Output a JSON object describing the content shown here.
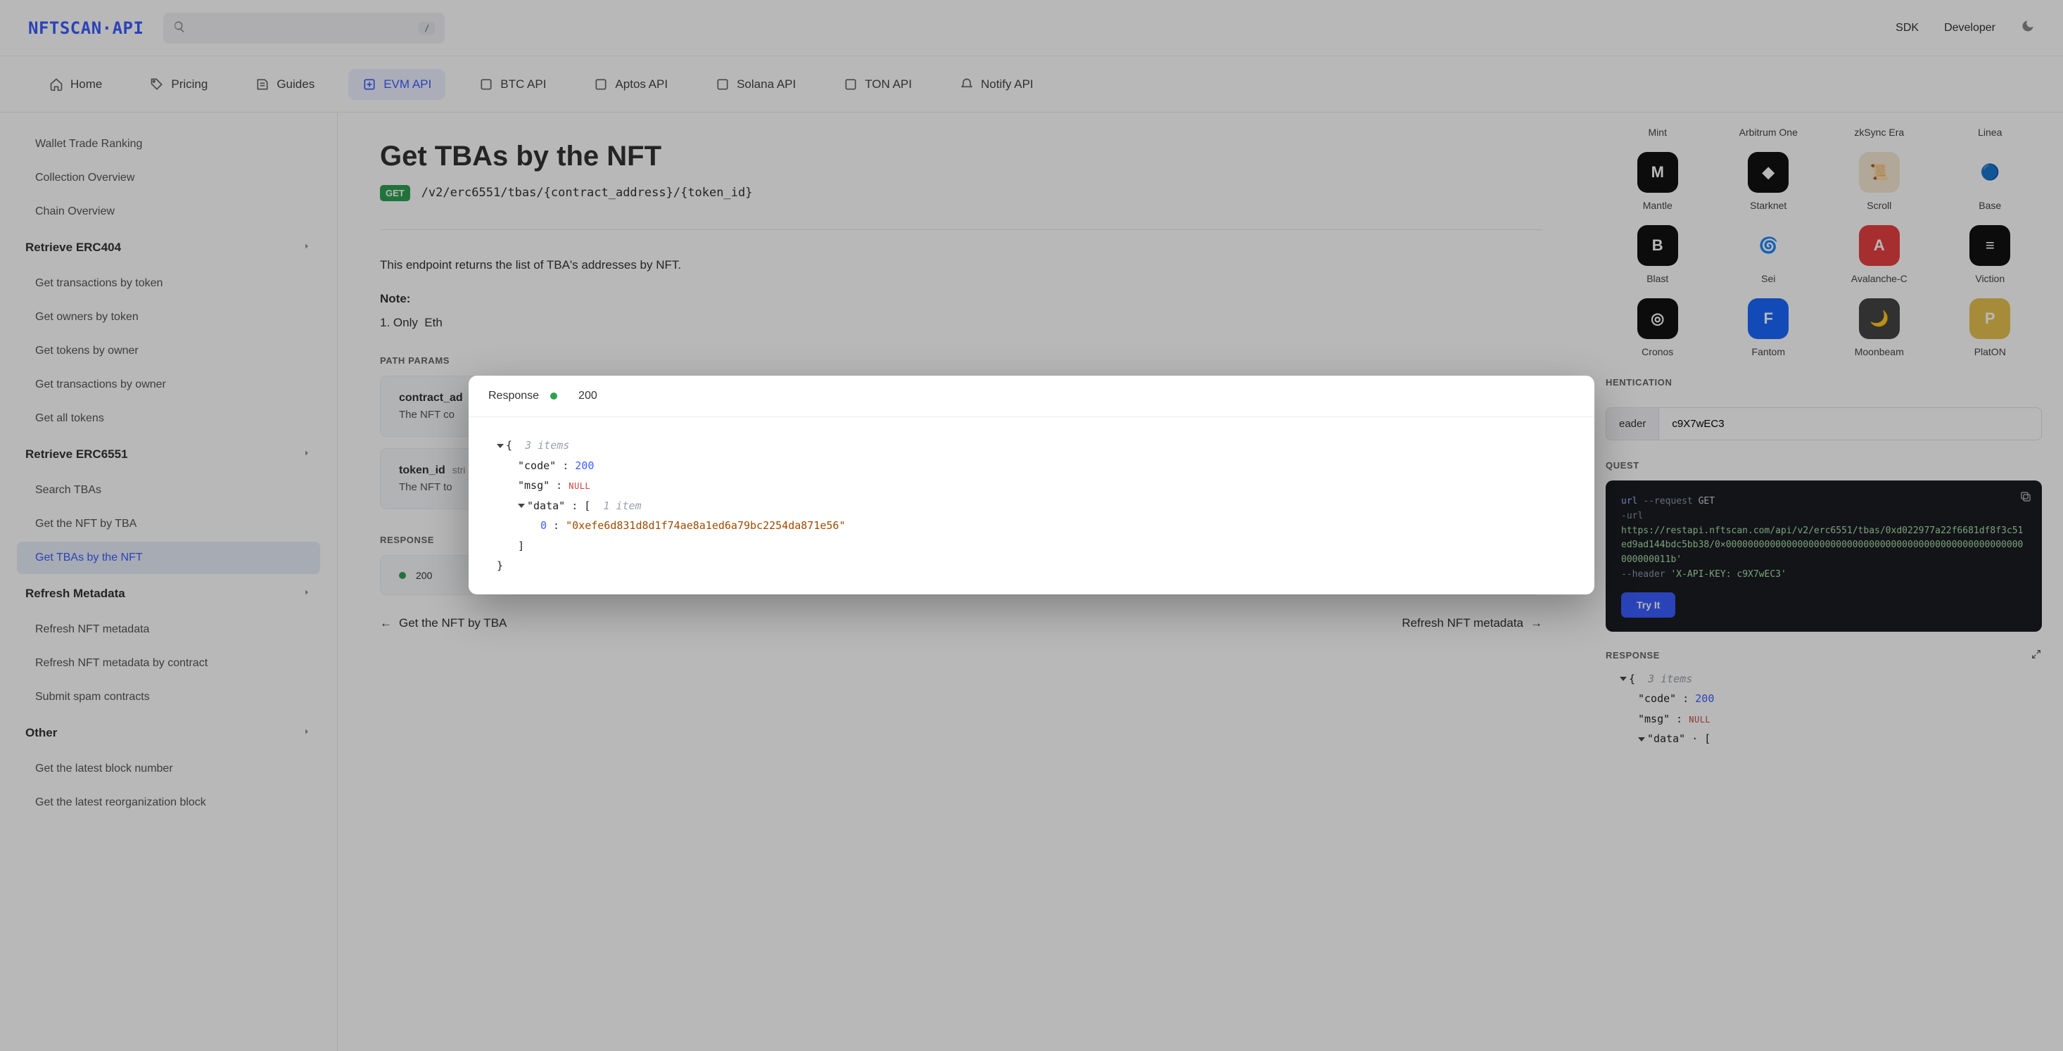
{
  "header": {
    "logo": "NFTSCAN·API",
    "search_placeholder": "",
    "search_shortcut": "/",
    "links": {
      "sdk": "SDK",
      "developer": "Developer"
    }
  },
  "tabs": [
    {
      "label": "Home"
    },
    {
      "label": "Pricing"
    },
    {
      "label": "Guides"
    },
    {
      "label": "EVM API",
      "active": true
    },
    {
      "label": "BTC API"
    },
    {
      "label": "Aptos API"
    },
    {
      "label": "Solana API"
    },
    {
      "label": "TON API"
    },
    {
      "label": "Notify API"
    }
  ],
  "sidebar": {
    "initial_items": [
      "Wallet Trade Ranking",
      "Collection Overview",
      "Chain Overview"
    ],
    "groups": [
      {
        "title": "Retrieve ERC404",
        "items": [
          "Get transactions by token",
          "Get owners by token",
          "Get tokens by owner",
          "Get transactions by owner",
          "Get all tokens"
        ]
      },
      {
        "title": "Retrieve ERC6551",
        "items": [
          "Search TBAs",
          "Get the NFT by TBA",
          "Get TBAs by the NFT"
        ],
        "active_index": 2
      },
      {
        "title": "Refresh Metadata",
        "items": [
          "Refresh NFT metadata",
          "Refresh NFT metadata by contract",
          "Submit spam contracts"
        ]
      },
      {
        "title": "Other",
        "items": [
          "Get the latest block number",
          "Get the latest reorganization block"
        ]
      }
    ]
  },
  "main": {
    "title": "Get TBAs by the NFT",
    "method": "GET",
    "endpoint": "/v2/erc6551/tbas/{contract_address}/{token_id}",
    "description": "This endpoint returns the list of TBA's addresses by NFT.",
    "note_label": "Note:",
    "note_item": "1. Only  Eth",
    "path_params_label": "PATH PARAMS",
    "params": [
      {
        "name": "contract_ad",
        "type": "",
        "desc": "The NFT co"
      },
      {
        "name": "token_id",
        "type": "stri",
        "desc": "The NFT to"
      }
    ],
    "response_label": "RESPONSE",
    "response_status": "200",
    "prev": "Get the NFT by TBA",
    "next": "Refresh NFT metadata"
  },
  "right": {
    "chains_top": [
      "Mint",
      "Arbitrum One",
      "zkSync Era",
      "Linea"
    ],
    "chains": [
      {
        "name": "Mantle",
        "bg": "#111",
        "glyph": "M"
      },
      {
        "name": "Starknet",
        "bg": "#111",
        "glyph": "◆"
      },
      {
        "name": "Scroll",
        "bg": "#f5e9d6",
        "glyph": "📜"
      },
      {
        "name": "Base",
        "bg": "#fff",
        "glyph": "🔵"
      },
      {
        "name": "Blast",
        "bg": "#111",
        "glyph": "B"
      },
      {
        "name": "Sei",
        "bg": "#fff",
        "glyph": "🌀"
      },
      {
        "name": "Avalanche-C",
        "bg": "#e84142",
        "glyph": "A"
      },
      {
        "name": "Viction",
        "bg": "#111",
        "glyph": "≡"
      },
      {
        "name": "Cronos",
        "bg": "#111",
        "glyph": "◎"
      },
      {
        "name": "Fantom",
        "bg": "#1969ff",
        "glyph": "F"
      },
      {
        "name": "Moonbeam",
        "bg": "#444",
        "glyph": "🌙"
      },
      {
        "name": "PlatON",
        "bg": "#e7c14f",
        "glyph": "P"
      }
    ],
    "auth_label": "HENTICATION",
    "header_label": "eader",
    "api_key": "c9X7wEC3",
    "request_label": "QUEST",
    "curl": {
      "cmd": "url",
      "flag1": "--request",
      "method": "GET",
      "flag2": "-url",
      "url": "https://restapi.nftscan.com/api/v2/erc6551/tbas/0xd022977a22f6681df8f3c51ed9ad144bdc5bb38/0×000000000000000000000000000000000000000000000000000000000000011b'",
      "flag3": "--header",
      "hdr": "'X-API-KEY: c9X7wEC3'"
    },
    "try_it": "Try It",
    "response_label": "RESPONSE",
    "json": {
      "items_meta": "3 items",
      "code_key": "\"code\"",
      "code_val": "200",
      "msg_key": "\"msg\"",
      "msg_val": "NULL",
      "data_key": "\"data\""
    }
  },
  "modal": {
    "title": "Response",
    "status": "200",
    "json": {
      "root_meta": "3 items",
      "code_key": "\"code\"",
      "code_val": "200",
      "msg_key": "\"msg\"",
      "msg_val": "NULL",
      "data_key": "\"data\"",
      "data_meta": "1 item",
      "idx0": "0",
      "val0": "\"0xefe6d831d8d1f74ae8a1ed6a79bc2254da871e56\""
    }
  }
}
